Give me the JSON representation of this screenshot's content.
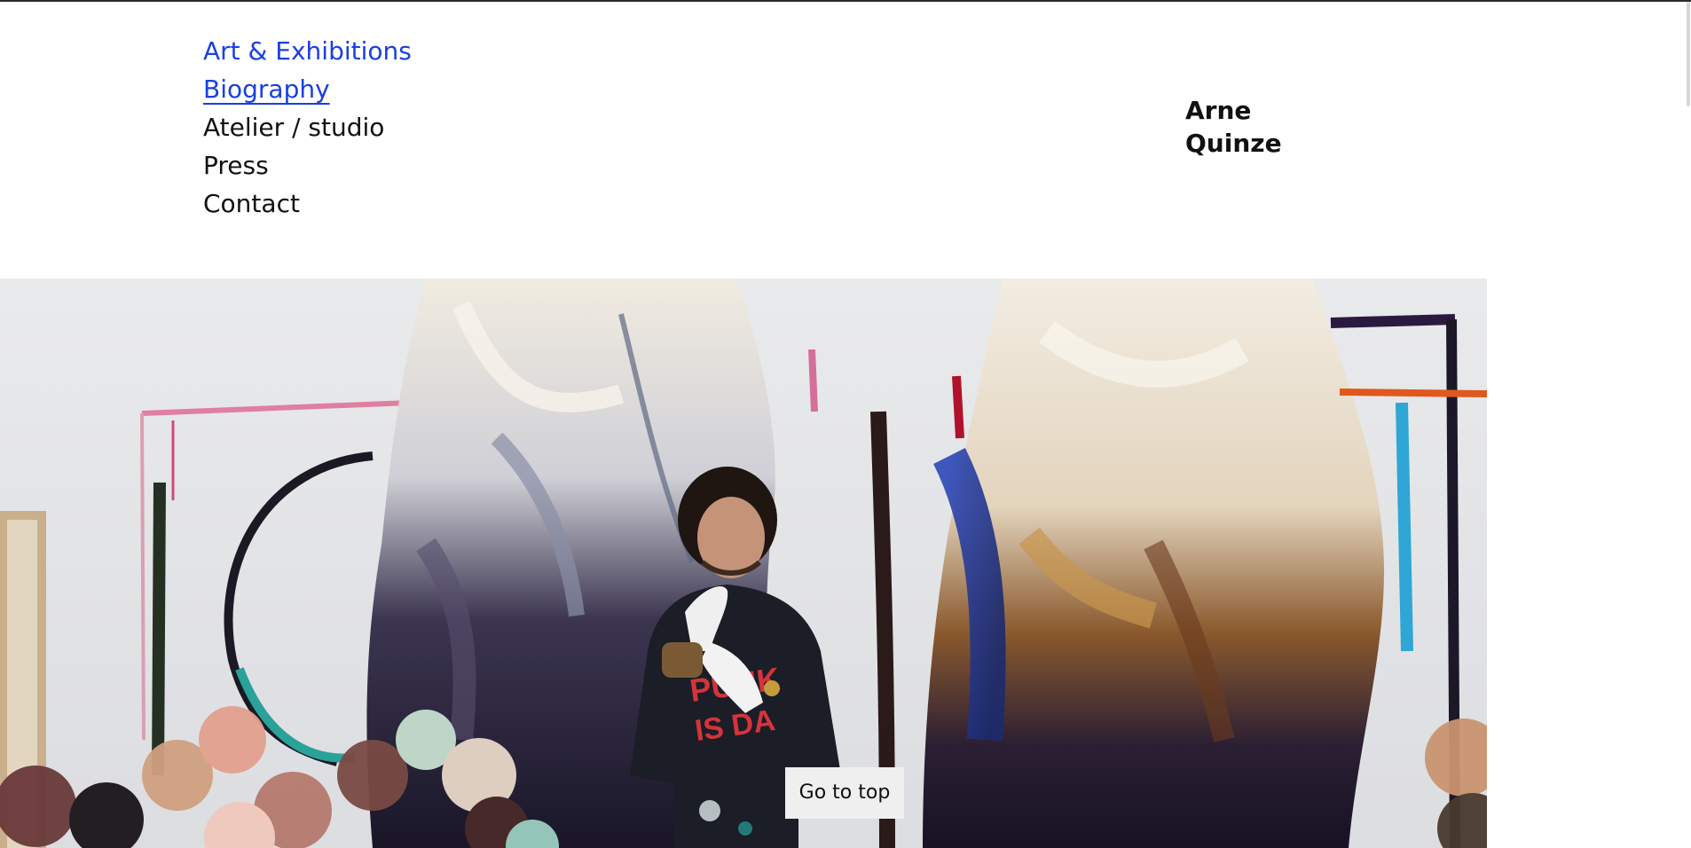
{
  "nav": {
    "items": [
      {
        "label": "Art & Exhibitions",
        "state": "link"
      },
      {
        "label": "Biography",
        "state": "current"
      },
      {
        "label": "Atelier / studio",
        "state": "default"
      },
      {
        "label": "Press",
        "state": "default"
      },
      {
        "label": "Contact",
        "state": "default"
      }
    ]
  },
  "brand": {
    "line1": "Arne",
    "line2": "Quinze"
  },
  "hero": {
    "image": "artist-in-studio-photo"
  },
  "go_top": {
    "label": "Go to top"
  },
  "colors": {
    "link": "#1a3fe0",
    "text": "#111111",
    "background": "#ffffff",
    "button_bg": "#efefef"
  }
}
